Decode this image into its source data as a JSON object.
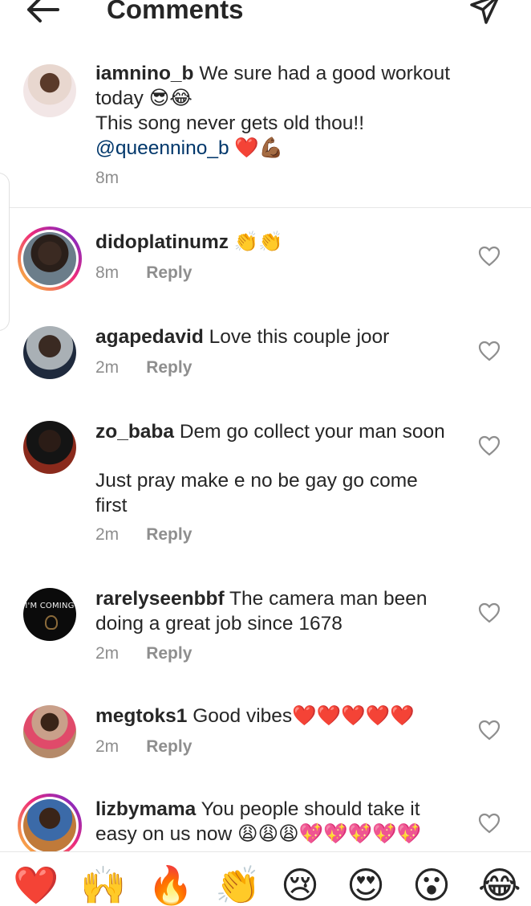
{
  "header": {
    "title": "Comments"
  },
  "caption": {
    "username": "iamnino_b",
    "line1": " We sure had a good workout",
    "line2": "today 😎😂",
    "line3": "This song never gets old thou!!",
    "mention": "@queennino_b",
    "mention_emoji": " ❤️💪🏾",
    "time": "8m"
  },
  "comments": [
    {
      "username": "didoplatinumz",
      "text": " 👏👏",
      "time": "8m",
      "reply": "Reply"
    },
    {
      "username": "agapedavid",
      "text": " Love this couple joor",
      "time": "2m",
      "reply": "Reply"
    },
    {
      "username": "zo_baba",
      "text": " Dem go collect your man soon",
      "text2": "Just pray make e no be gay go come",
      "text3": "first",
      "time": "2m",
      "reply": "Reply"
    },
    {
      "username": "rarelyseenbbf",
      "text": " The camera man been",
      "text2": "doing a great job since 1678",
      "avatar_text": "I'M COMING",
      "time": "2m",
      "reply": "Reply"
    },
    {
      "username": "megtoks1",
      "text": " Good vibes❤️❤️❤️❤️❤️",
      "time": "2m",
      "reply": "Reply"
    },
    {
      "username": "lizbymama",
      "text": " You people should take it",
      "text2": "easy on us now 😩😩😩💖💖💖💖💖"
    }
  ],
  "emoji_bar": [
    "❤️",
    "🙌",
    "🔥",
    "👏",
    "😢",
    "😍",
    "😮",
    "😂"
  ],
  "colors": {
    "mention": "#00376b",
    "meta": "#8e8e8e",
    "text": "#262626"
  }
}
